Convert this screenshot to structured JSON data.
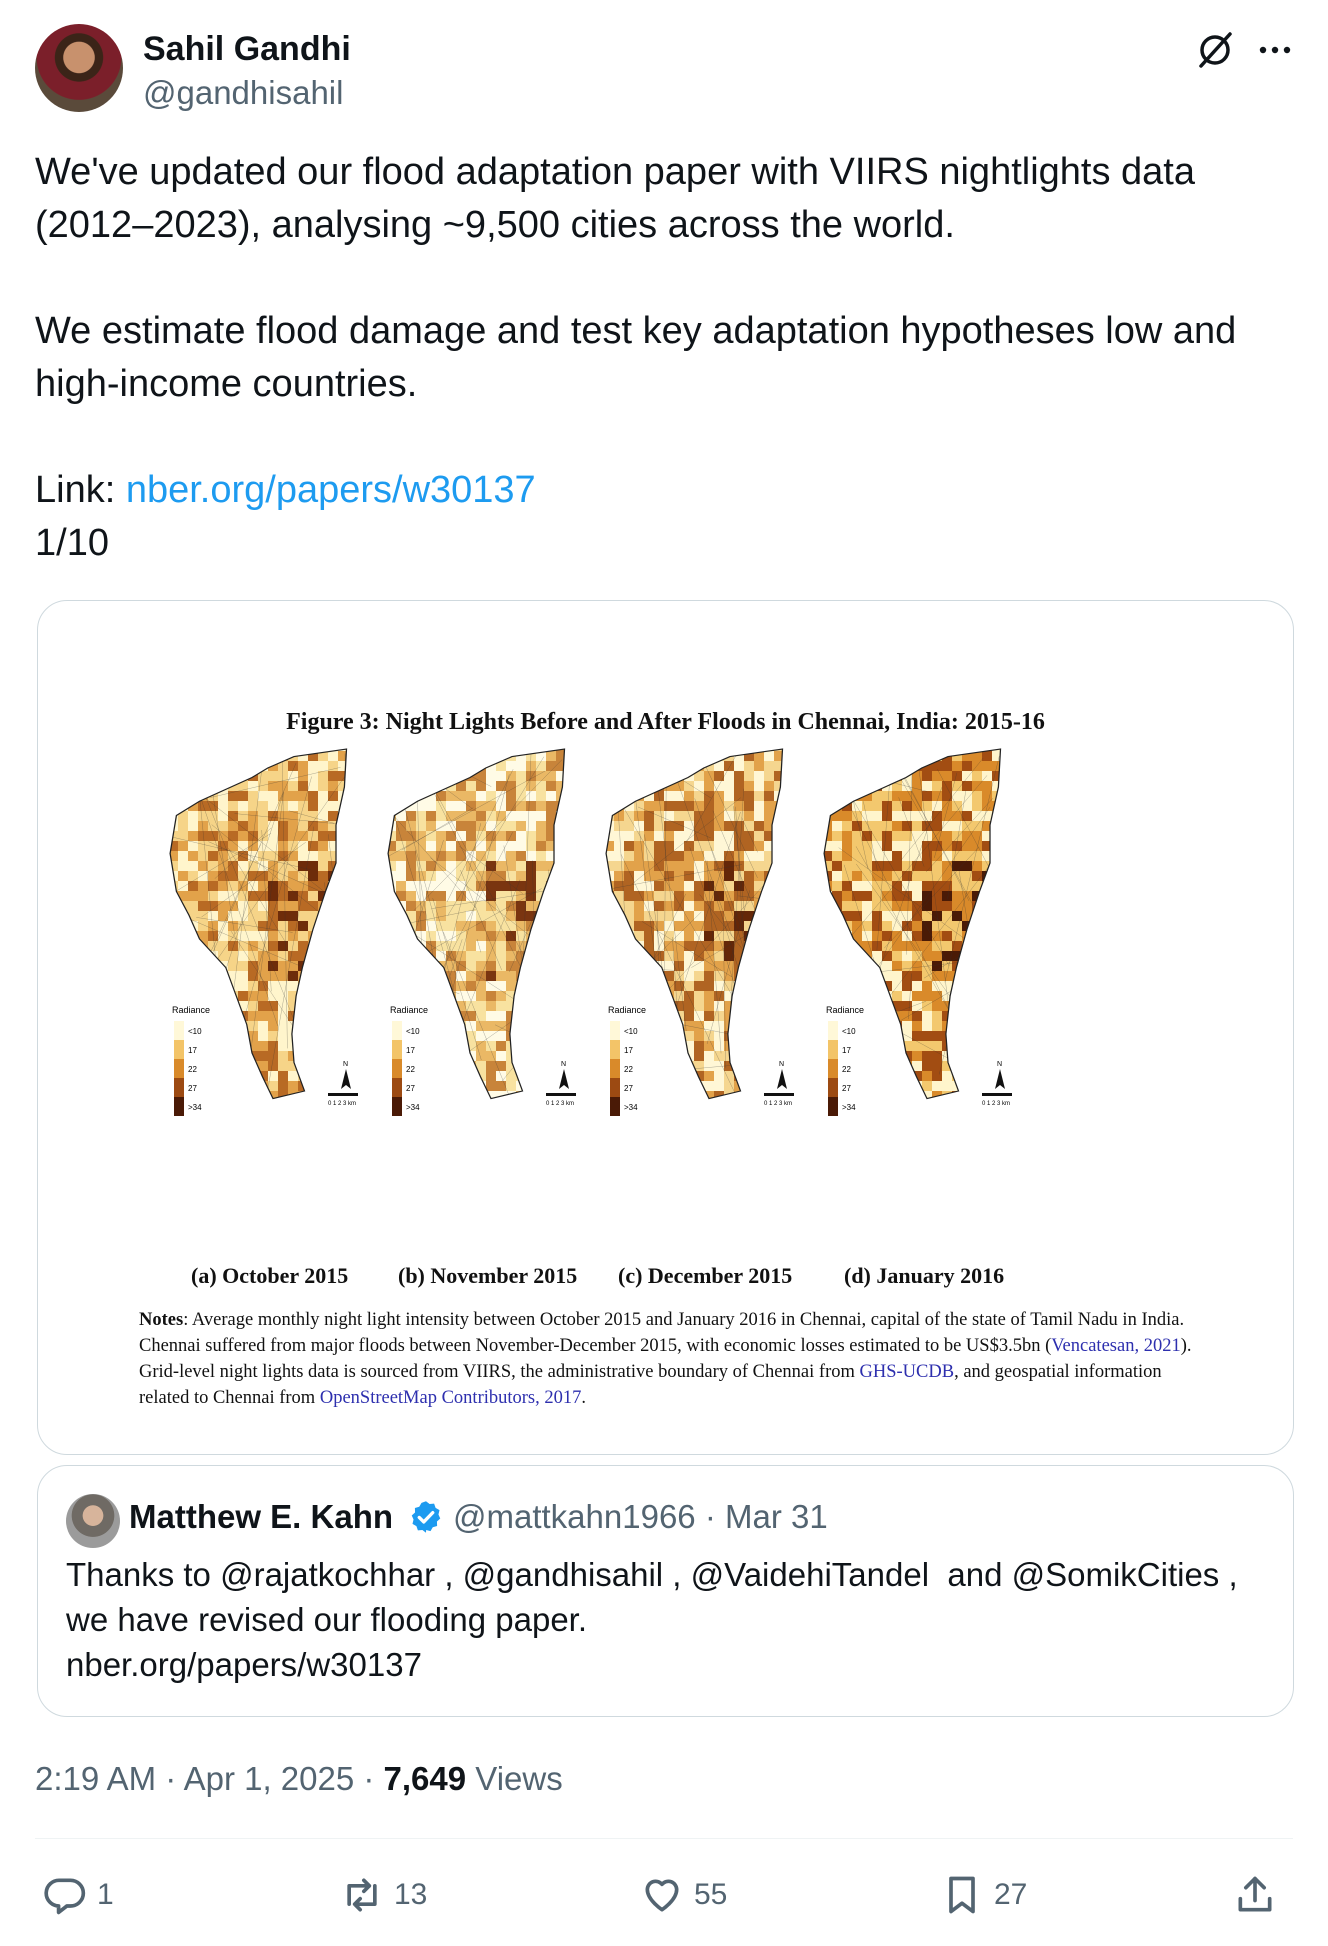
{
  "author": {
    "name": "Sahil Gandhi",
    "handle": "@gandhisahil"
  },
  "tweet": {
    "line1": "We've updated our flood adaptation paper with VIIRS nightlights data (2012–2023), analysing ~9,500 cities across the world.",
    "line2": "We estimate flood damage and test key adaptation hypotheses low and high-income countries.",
    "link_prefix": "Link: ",
    "link_text": "nber.org/papers/w30137",
    "thread_count": "1/10"
  },
  "figure": {
    "title": "Figure 3: Night Lights Before and After Floods in Chennai, India: 2015-16",
    "legend_title": "Radiance",
    "legend_values": [
      "<10",
      "17",
      "22",
      "27",
      ">34"
    ],
    "legend_colors": [
      "#fff8d8",
      "#f3c468",
      "#d98a2a",
      "#9c4a12",
      "#4a1a06"
    ],
    "scale_label": "0 1 2 3 km",
    "north_label": "N",
    "panels": [
      {
        "caption": "(a) October 2015"
      },
      {
        "caption": "(b) November 2015"
      },
      {
        "caption": "(c) December 2015"
      },
      {
        "caption": "(d) January 2016"
      }
    ],
    "notes_label": "Notes",
    "notes_1": ": Average monthly night light intensity between October 2015 and January 2016 in Chennai, capital of the state of Tamil Nadu in India. Chennai suffered from major floods between November-December 2015, with economic losses estimated to be US$3.5bn (",
    "notes_ref1": "Vencatesan, 2021",
    "notes_2": "). Grid-level night lights data is sourced from VIIRS, the administrative boundary of Chennai from ",
    "notes_ref2": "GHS-UCDB",
    "notes_3": ", and geospatial information related to Chennai from ",
    "notes_ref3": "OpenStreetMap Contributors, 2017",
    "notes_4": "."
  },
  "quoted": {
    "name": "Matthew E. Kahn",
    "handle_date": "@mattkahn1966 · Mar 31",
    "text": "Thanks to @rajatkochhar , @gandhisahil , @VaidehiTandel  and @SomikCities , we have revised our flooding paper.\nnber.org/papers/w30137"
  },
  "meta": {
    "time_date": "2:19 AM · Apr 1, 2025 · ",
    "views_count": "7,649",
    "views_label": " Views"
  },
  "actions": {
    "replies": "1",
    "reposts": "13",
    "likes": "55",
    "bookmarks": "27"
  },
  "colors": {
    "link": "#1d9bf0",
    "verified": "#1d9bf0",
    "muted": "#536471"
  }
}
